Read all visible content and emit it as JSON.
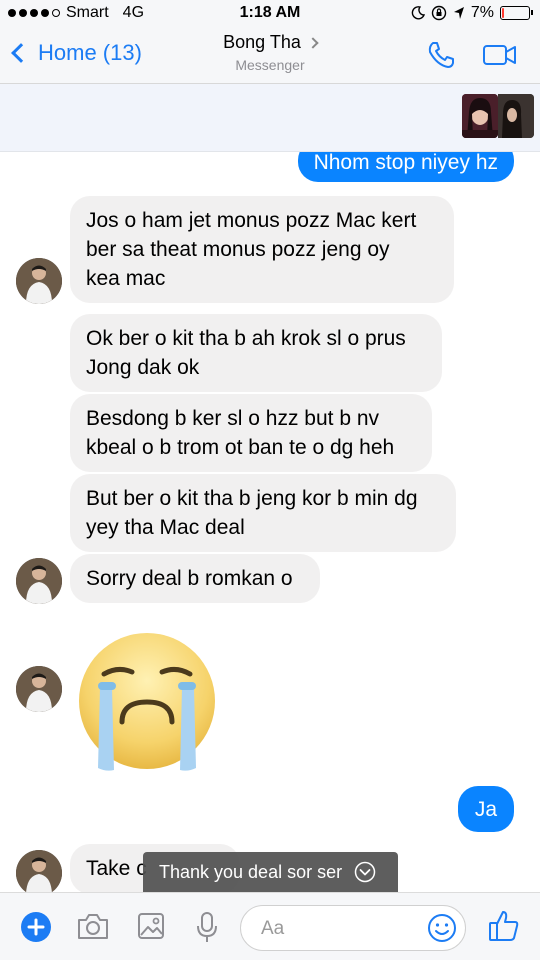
{
  "status": {
    "carrier": "Smart",
    "network": "4G",
    "time": "1:18 AM",
    "battery": "7%",
    "battery_level": 0.07
  },
  "header": {
    "back_label": "Home (13)",
    "contact_name": "Bong Tha",
    "subtitle": "Messenger"
  },
  "messages": [
    {
      "dir": "out",
      "text": "Nhom stop niyey hz"
    },
    {
      "dir": "in",
      "lines": [
        "Jos o ham jet monus pozz Mac kert",
        "ber sa theat monus pozz jeng oy",
        "kea mac"
      ]
    },
    {
      "dir": "in",
      "lines": [
        "Ok ber o kit tha b ah krok sl o prus",
        "Jong dak ok"
      ]
    },
    {
      "dir": "in",
      "lines": [
        "Besdong b ker sl o hzz but b nv",
        "kbeal o b trom ot ban te o dg heh"
      ]
    },
    {
      "dir": "in",
      "lines": [
        "But ber o kit tha b jeng kor b min dg",
        "yey tha Mac deal"
      ]
    },
    {
      "dir": "in",
      "lines": [
        "Sorry deal b romkan o"
      ]
    },
    {
      "dir": "in",
      "emoji": "crying-face"
    },
    {
      "dir": "out",
      "text": "Ja"
    },
    {
      "dir": "in",
      "text": "Take c"
    }
  ],
  "toast": {
    "text": "Thank you deal sor ser"
  },
  "composer": {
    "placeholder": "Aa"
  },
  "colors": {
    "accent": "#1c7cf4",
    "outgoing_bubble": "#0a84ff",
    "incoming_bubble": "#f1f0f0"
  }
}
